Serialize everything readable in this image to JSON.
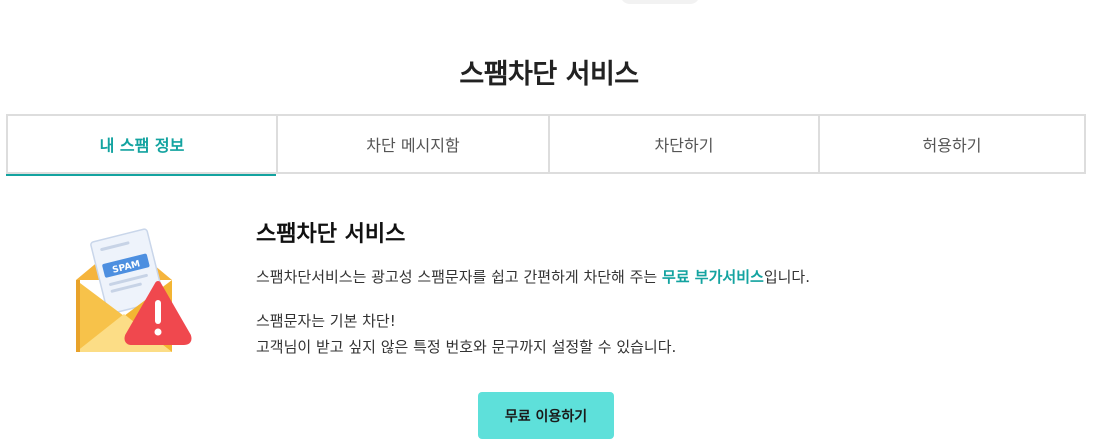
{
  "page": {
    "title": "스팸차단 서비스"
  },
  "tabs": [
    {
      "label": "내 스팸 정보",
      "active": true
    },
    {
      "label": "차단 메시지함",
      "active": false
    },
    {
      "label": "차단하기",
      "active": false
    },
    {
      "label": "허용하기",
      "active": false
    }
  ],
  "content": {
    "heading": "스팸차단 서비스",
    "desc_line1_prefix": "스팸차단서비스는 광고성 스팸문자를 쉽고 간편하게 차단해 주는 ",
    "desc_line1_highlight": "무료 부가서비스",
    "desc_line1_suffix": "입니다.",
    "desc_line2": "스팸문자는 기본 차단!",
    "desc_line3": "고객님이 받고 싶지 않은 특정 번호와 문구까지 설정할 수 있습니다.",
    "illustration_label": "SPAM"
  },
  "cta": {
    "label": "무료 이용하기"
  },
  "colors": {
    "accent": "#13a3a0",
    "button_bg": "#5ee0da",
    "warning_red": "#f0484e",
    "envelope_yellow": "#f7c24a"
  }
}
